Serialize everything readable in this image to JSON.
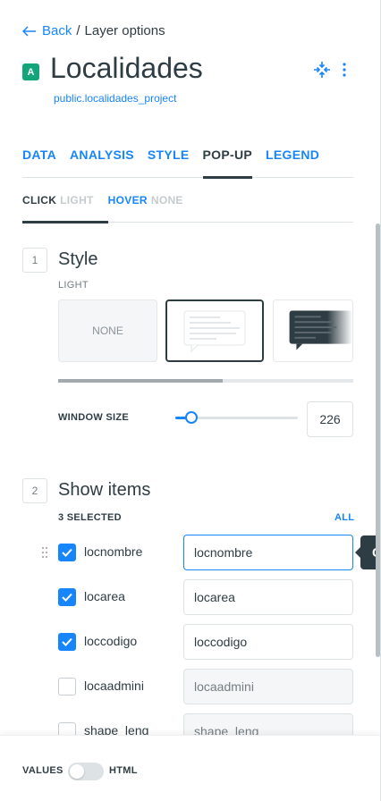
{
  "breadcrumb": {
    "back_label": "Back",
    "separator": "/",
    "current": "Layer options"
  },
  "layer": {
    "badge": "A",
    "badge_color": "#11a579",
    "title": "Localidades",
    "source": "public.localidades_project"
  },
  "header_icons": [
    "expand-arrows-icon",
    "more-vertical-icon"
  ],
  "tabs": [
    {
      "label": "DATA"
    },
    {
      "label": "ANALYSIS"
    },
    {
      "label": "STYLE"
    },
    {
      "label": "POP-UP",
      "active": true
    },
    {
      "label": "LEGEND"
    }
  ],
  "subtabs": [
    {
      "label": "CLICK",
      "state": "LIGHT",
      "active": true
    },
    {
      "label": "HOVER",
      "state": "NONE"
    }
  ],
  "style_section": {
    "step": "1",
    "title": "Style",
    "selected_label": "LIGHT",
    "options": [
      {
        "label": "NONE"
      },
      {
        "label": "",
        "icon": "light-popup-icon",
        "selected": true
      },
      {
        "label": "",
        "icon": "dark-popup-icon"
      }
    ],
    "window_size_label": "WINDOW SIZE",
    "window_size_value": "226",
    "window_size_fraction": 0.13
  },
  "items_section": {
    "step": "2",
    "title": "Show items",
    "selected_count": "3 SELECTED",
    "all_label": "ALL",
    "items": [
      {
        "name": "locnombre",
        "value": "locnombre",
        "checked": true,
        "focused": true
      },
      {
        "name": "locarea",
        "value": "locarea",
        "checked": true
      },
      {
        "name": "loccodigo",
        "value": "loccodigo",
        "checked": true
      },
      {
        "name": "locaadmini",
        "value": "locaadmini",
        "checked": false
      },
      {
        "name": "shape_leng",
        "value": "shape_leng",
        "checked": false
      }
    ],
    "tooltip_text": "C"
  },
  "footer": {
    "left_label": "VALUES",
    "right_label": "HTML",
    "toggle_on": false
  },
  "colors": {
    "accent": "#1785fb",
    "text": "#2e3c43",
    "muted": "#747d82"
  }
}
